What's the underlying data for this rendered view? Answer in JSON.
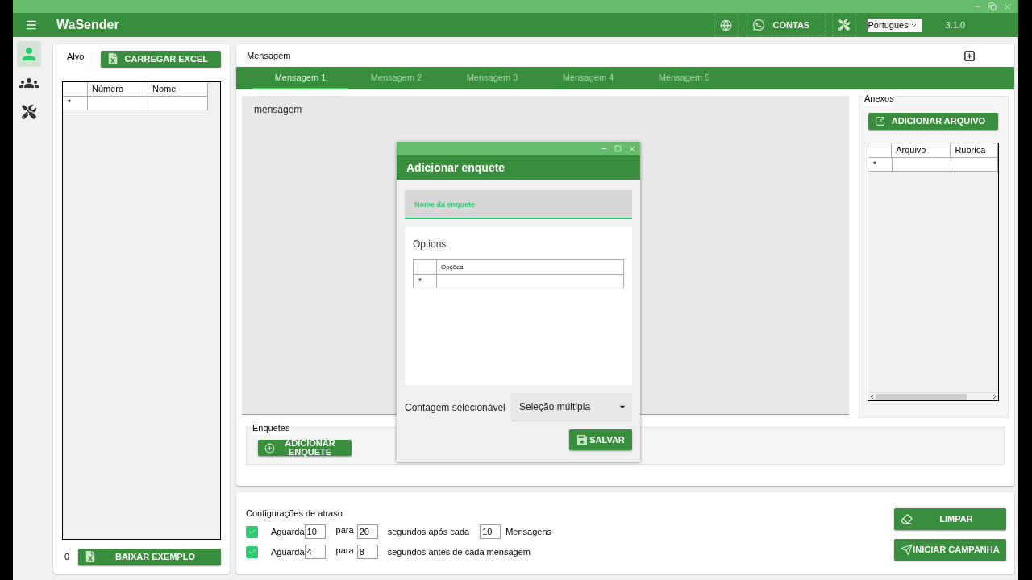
{
  "app_bar": {
    "title": "WaSender",
    "accounts_label": "CONTAS",
    "language": "Portugues",
    "version": "3.1.0"
  },
  "nav": [
    {
      "kind": "person",
      "selected": true
    },
    {
      "kind": "group",
      "selected": false
    },
    {
      "kind": "tools",
      "selected": false
    }
  ],
  "target": {
    "title": "Alvo",
    "load_button": "CARREGAR EXCEL",
    "columns": [
      "Número",
      "Nome"
    ],
    "new_row_marker": "*",
    "count": "0",
    "example_button": "BAIXAR EXEMPLO"
  },
  "message": {
    "title": "Mensagem",
    "tabs": [
      {
        "label": "Mensagem 1",
        "selected": true
      },
      {
        "label": "Mensagem 2",
        "selected": false
      },
      {
        "label": "Mensagem 3",
        "selected": false
      },
      {
        "label": "Mensagem 4",
        "selected": false
      },
      {
        "label": "Mensagem 5",
        "selected": false
      }
    ],
    "placeholder": "mensagem",
    "attachments": {
      "title": "Anexos",
      "add_button": "ADICIONAR ARQUIVO",
      "columns": [
        "Arquivo",
        "Rubrica"
      ],
      "new_row_marker": "*"
    },
    "polls": {
      "title": "Enquetes",
      "add_button": "ADICIONAR ENQUETE"
    }
  },
  "dialog": {
    "title": "Adicionar enquete",
    "name_field": {
      "label": "Nome da enquete"
    },
    "options": {
      "title": "Options",
      "columns": [
        "Opções"
      ],
      "new_row_marker": "*"
    },
    "count_label": "Contagem selecionável",
    "count_value": "Seleção múltipla",
    "save_button": "SALVAR"
  },
  "delay": {
    "title": "Configurações de atraso",
    "rows": [
      {
        "checked": true,
        "wait_label": "Aguarda",
        "min": "10",
        "to_label": "para",
        "max": "20",
        "text": "segundos após cada",
        "count": "10",
        "unit": "Mensagens"
      },
      {
        "checked": true,
        "wait_label": "Aguarda",
        "min": "4",
        "to_label": "para",
        "max": "8",
        "text": "segundos antes de cada mensagem"
      }
    ]
  },
  "actions": {
    "clear_button": "LIMPAR",
    "start_button": "INICIAR CAMPANHA"
  }
}
